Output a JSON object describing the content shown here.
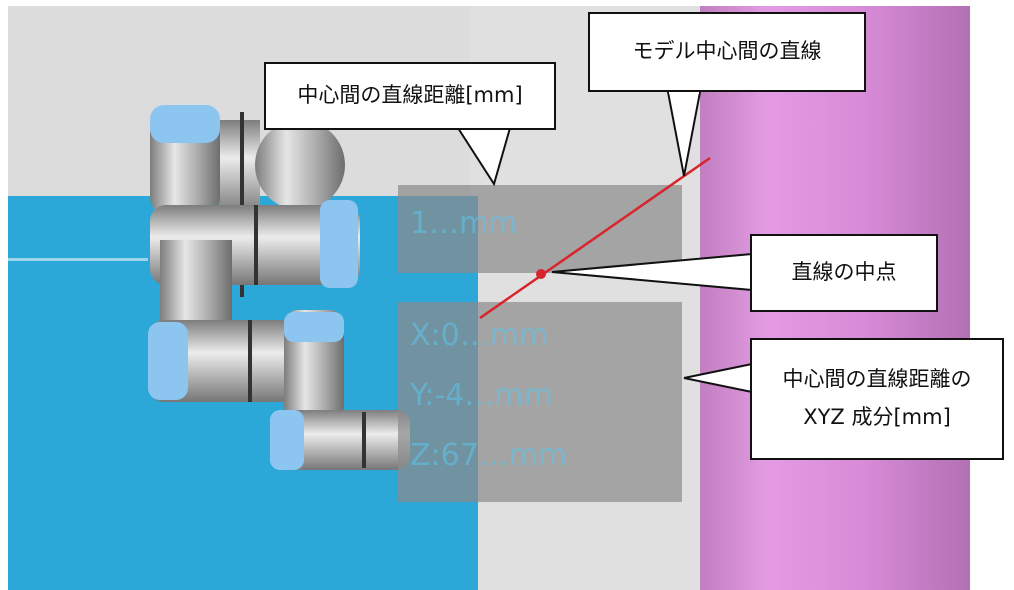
{
  "callouts": {
    "model_center_line": "モデル中心間の直線",
    "center_distance": "中心間の直線距離[mm]",
    "midpoint": "直線の中点",
    "xyz_components_line1": "中心間の直線距離の",
    "xyz_components_line2": "XYZ 成分[mm]"
  },
  "overlay": {
    "distance_value": "1…mm",
    "x_value": "X:0…mm",
    "y_value": "Y:-4…mm",
    "z_value": "Z:67…mm"
  },
  "colors": {
    "floor_blue": "#2ba7d8",
    "pillar_magenta": "#d88bd7",
    "line_red": "#d8242c",
    "overlay_text": "#5cc6ee"
  }
}
